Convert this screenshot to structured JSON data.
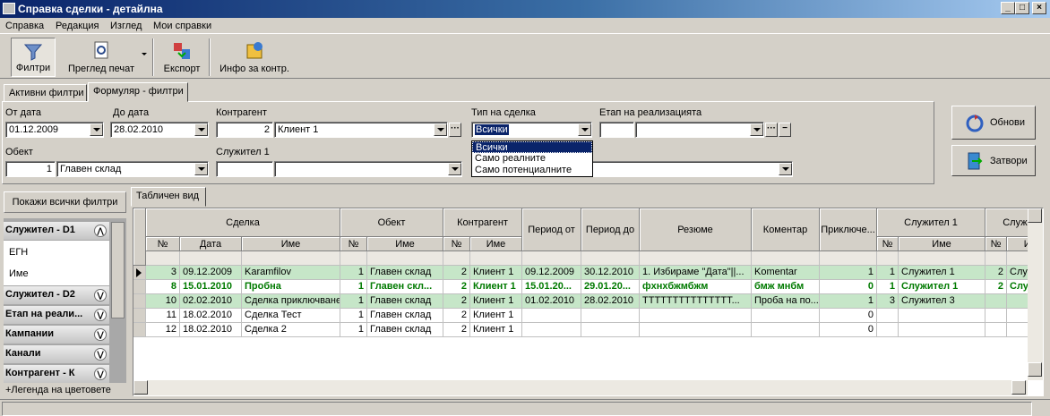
{
  "window": {
    "title": "Справка сделки - детайлна"
  },
  "menu": [
    "Справка",
    "Редакция",
    "Изглед",
    "Мои справки"
  ],
  "toolbar": {
    "filters": "Филтри",
    "print_preview": "Преглед печат",
    "export": "Експорт",
    "info": "Инфо за контр."
  },
  "tabs": {
    "active_filters": "Активни филтри",
    "form_filters": "Формуляр - филтри"
  },
  "filters": {
    "from_date_label": "От дата",
    "from_date": "01.12.2009",
    "to_date_label": "До дата",
    "to_date": "28.02.2010",
    "contragent_label": "Контрагент",
    "contragent_code": "2",
    "contragent_name": "Клиент 1",
    "deal_type_label": "Тип на сделка",
    "deal_type": "Всички",
    "stage_label": "Етап на реализацията",
    "object_label": "Обект",
    "object_code": "1",
    "object_name": "Главен склад",
    "employee_label": "Служител 1",
    "deal_type_options": [
      "Всички",
      "Само реалните",
      "Само потенциалните"
    ]
  },
  "buttons": {
    "refresh": "Обнови",
    "close": "Затвори"
  },
  "left_panel": {
    "show_all": "Покажи всички филтри",
    "groups": [
      "Служител - D1",
      "Служител - D2",
      "Етап на реали...",
      "Кампании",
      "Канали",
      "Контрагент - К"
    ],
    "items": [
      "ЕГН",
      "Име"
    ],
    "legend": "+Легенда на цветовете"
  },
  "grid": {
    "tab": "Табличен вид",
    "groups": {
      "deal": "Сделка",
      "object": "Обект",
      "contragent": "Контрагент",
      "period_from": "Период от",
      "period_to": "Период до",
      "summary": "Резюме",
      "comment": "Коментар",
      "finished": "Приключе...",
      "employee1": "Служител 1",
      "employee2": "Служите"
    },
    "sub": {
      "no": "№",
      "date": "Дата",
      "name": "Име"
    },
    "rows": [
      {
        "no": "3",
        "date": "09.12.2009",
        "name": "Karamfilov",
        "obj_no": "1",
        "obj_name": "Главен склад",
        "c_no": "2",
        "c_name": "Клиент 1",
        "p_from": "09.12.2009",
        "p_to": "30.12.2010",
        "summary": "1. Избираме \"Дата\"||...",
        "comment": "Komentar",
        "fin": "1",
        "e1_no": "1",
        "e1_name": "Служител 1",
        "e2_no": "2",
        "e2_name": "Служите"
      },
      {
        "no": "8",
        "date": "15.01.2010",
        "name": "Пробна",
        "obj_no": "1",
        "obj_name": "Главен скл...",
        "c_no": "2",
        "c_name": "Клиент 1",
        "p_from": "15.01.20...",
        "p_to": "29.01.20...",
        "summary": "фхнхбжмбжм",
        "comment": "бмж мнбм",
        "fin": "0",
        "e1_no": "1",
        "e1_name": "Служител 1",
        "e2_no": "2",
        "e2_name": "Служи"
      },
      {
        "no": "10",
        "date": "02.02.2010",
        "name": "Сделка приключване",
        "obj_no": "1",
        "obj_name": "Главен склад",
        "c_no": "2",
        "c_name": "Клиент 1",
        "p_from": "01.02.2010",
        "p_to": "28.02.2010",
        "summary": "ТТТТТТТТТТТТТТТ...",
        "comment": "Проба на по...",
        "fin": "1",
        "e1_no": "3",
        "e1_name": "Служител 3",
        "e2_no": "",
        "e2_name": ""
      },
      {
        "no": "11",
        "date": "18.02.2010",
        "name": "Сделка Тест",
        "obj_no": "1",
        "obj_name": "Главен склад",
        "c_no": "2",
        "c_name": "Клиент 1",
        "p_from": "",
        "p_to": "",
        "summary": "",
        "comment": "",
        "fin": "0",
        "e1_no": "",
        "e1_name": "",
        "e2_no": "",
        "e2_name": ""
      },
      {
        "no": "12",
        "date": "18.02.2010",
        "name": "Сделка 2",
        "obj_no": "1",
        "obj_name": "Главен склад",
        "c_no": "2",
        "c_name": "Клиент 1",
        "p_from": "",
        "p_to": "",
        "summary": "",
        "comment": "",
        "fin": "0",
        "e1_no": "",
        "e1_name": "",
        "e2_no": "",
        "e2_name": ""
      }
    ]
  },
  "colors": {
    "green_row": "#c6e6c8",
    "bold_text": "#007a00",
    "selection": "#0a246a"
  }
}
